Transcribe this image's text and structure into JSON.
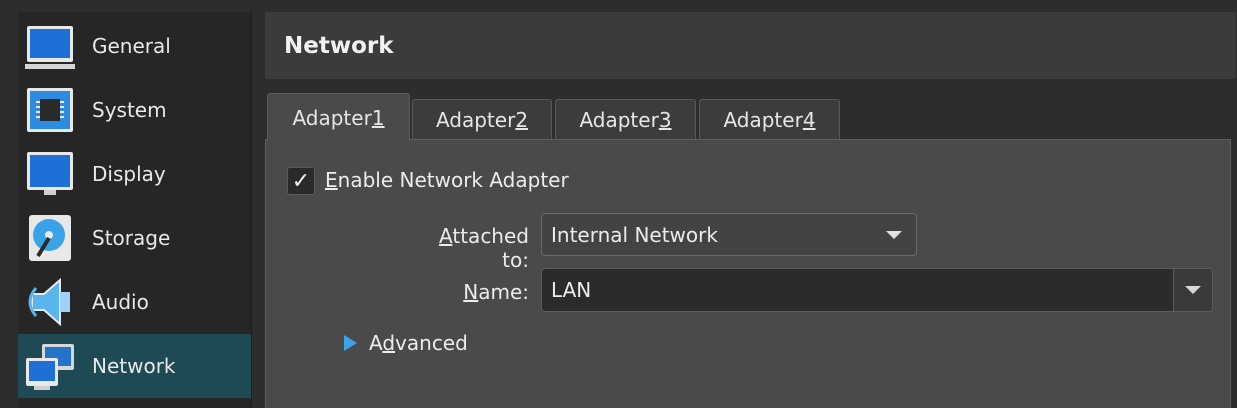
{
  "sidebar": {
    "items": [
      {
        "label": "General",
        "icon": "general-icon"
      },
      {
        "label": "System",
        "icon": "system-chip-icon"
      },
      {
        "label": "Display",
        "icon": "display-monitor-icon"
      },
      {
        "label": "Storage",
        "icon": "storage-disk-icon"
      },
      {
        "label": "Audio",
        "icon": "audio-speaker-icon"
      },
      {
        "label": "Network",
        "icon": "network-icon",
        "selected": true
      }
    ]
  },
  "header": {
    "title": "Network"
  },
  "tabs": [
    {
      "prefix": "Adapter ",
      "mnemonic": "1",
      "active": true
    },
    {
      "prefix": "Adapter ",
      "mnemonic": "2"
    },
    {
      "prefix": "Adapter ",
      "mnemonic": "3"
    },
    {
      "prefix": "Adapter ",
      "mnemonic": "4"
    }
  ],
  "enable": {
    "mnemonic": "E",
    "rest": "nable Network Adapter",
    "checked": true,
    "check_glyph": "✓"
  },
  "attached": {
    "label_mnemonic": "A",
    "label_rest": "ttached to:",
    "value": "Internal Network"
  },
  "name": {
    "label_mnemonic": "N",
    "label_rest": "ame:",
    "value": "LAN"
  },
  "advanced": {
    "pre": "A",
    "mnemonic": "d",
    "rest": "vanced"
  },
  "colors": {
    "accent": "#3ea2e8",
    "selected_bg": "#1e4a53"
  }
}
